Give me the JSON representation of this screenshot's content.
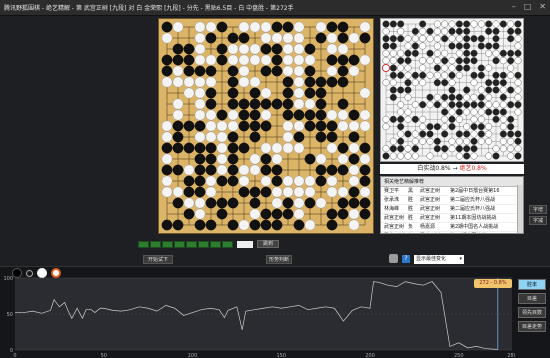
{
  "window": {
    "title": "腾讯野狐围棋 - 绝艺精解 - 第 武宫正树 [九段] 对 白 金荣熙 [九段] - 分先 - 黑贴6.5目 - 白 中盘胜 - 第272手",
    "minimize": "–",
    "maximize": "□",
    "close": "✕"
  },
  "side_panel": {
    "black_rate": "白实战0.8%",
    "arrow": "→",
    "ai_rate": "绝艺0.8%"
  },
  "commentary": {
    "header": "相关绝艺精解推荐",
    "rows": [
      [
        "赛卫平",
        "黑",
        "武宫正树",
        "第2届中日擂台赛第16"
      ],
      [
        "张承洙",
        "胜",
        "武宫正树",
        "第二届应氏杯八强战"
      ],
      [
        "林海峰",
        "胜",
        "武宫正树",
        "第二届应氏杯八强战"
      ],
      [
        "武宫正树",
        "胜",
        "武宫正树",
        "第11期本因坊战挑战"
      ],
      [
        "武宫正树",
        "负",
        "杨嘉源",
        "第2期中国名人战挑战"
      ],
      [
        "武宫正树",
        "负",
        "武宫正树",
        "第10期本因坊战"
      ]
    ]
  },
  "font_buttons": [
    "字增",
    "字减"
  ],
  "nav": {
    "move_value": "",
    "jump": "跳到"
  },
  "buttons": {
    "try": "开始试下",
    "analysis": "形势判断",
    "dropdown": "显示最佳变化",
    "dropdown_arrow": "▾",
    "help": "?"
  },
  "chart_tag": "272  -  0.8%",
  "right_buttons": [
    "胜率",
    "目差",
    "领先目数",
    "目差走势"
  ],
  "chart_data": {
    "type": "line",
    "x": [
      0,
      5,
      10,
      15,
      20,
      22,
      25,
      28,
      30,
      32,
      35,
      38,
      40,
      43,
      45,
      48,
      50,
      55,
      60,
      65,
      70,
      75,
      80,
      85,
      90,
      95,
      100,
      105,
      110,
      115,
      118,
      120,
      125,
      128,
      130,
      135,
      140,
      145,
      150,
      155,
      160,
      165,
      170,
      175,
      180,
      185,
      190,
      195,
      200,
      202,
      205,
      210,
      215,
      220,
      225,
      230,
      235,
      240,
      245,
      250,
      255,
      260,
      265,
      270,
      272
    ],
    "y": [
      52,
      52,
      54,
      51,
      55,
      70,
      60,
      66,
      54,
      44,
      58,
      44,
      56,
      56,
      52,
      58,
      58,
      55,
      54,
      56,
      60,
      58,
      54,
      62,
      58,
      48,
      52,
      56,
      58,
      56,
      45,
      55,
      60,
      28,
      54,
      56,
      58,
      60,
      58,
      60,
      62,
      56,
      58,
      60,
      58,
      40,
      55,
      60,
      58,
      95,
      94,
      90,
      88,
      95,
      92,
      90,
      95,
      80,
      5,
      10,
      3,
      5,
      2,
      1,
      1
    ],
    "xticks": [
      0,
      50,
      100,
      150,
      200,
      250,
      280
    ],
    "yticks": [
      0,
      50,
      100
    ],
    "xlim": [
      0,
      280
    ],
    "ylim": [
      0,
      100
    ],
    "line_color": "#cfcfcf",
    "marker_x": 272
  }
}
